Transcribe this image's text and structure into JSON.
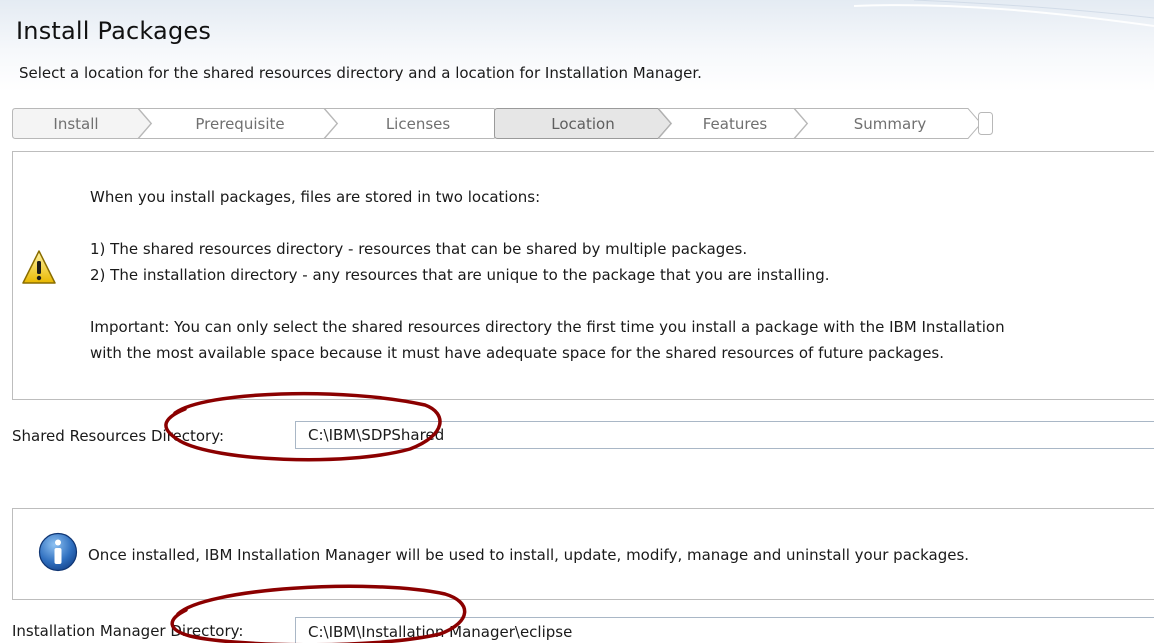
{
  "header": {
    "title": "Install Packages",
    "subtitle": "Select a location for the shared resources directory and a location for Installation Manager."
  },
  "wizard": {
    "steps": [
      {
        "label": "Install",
        "active": false
      },
      {
        "label": "Prerequisite",
        "active": false
      },
      {
        "label": "Licenses",
        "active": false
      },
      {
        "label": "Location",
        "active": true
      },
      {
        "label": "Features",
        "active": false
      },
      {
        "label": "Summary",
        "active": false
      }
    ]
  },
  "warning_panel": {
    "icon": "warning-icon",
    "intro": "When you install packages, files are stored in two locations:",
    "item1": "1) The shared resources directory - resources that can be shared by multiple packages.",
    "item2": "2) The installation directory - any resources that are unique to the package that you are installing.",
    "important_line1": "Important: You can only select the shared resources directory the first time you install a package with the IBM Installation",
    "important_line2": "with the most available space because it must have adequate space for the shared resources of future packages."
  },
  "shared_resources": {
    "label": "Shared Resources Directory:",
    "value": "C:\\IBM\\SDPShared"
  },
  "info_panel": {
    "icon": "info-icon",
    "text": "Once installed, IBM Installation Manager will be used to install, update, modify, manage and uninstall your packages."
  },
  "installation_manager": {
    "label": "Installation Manager Directory:",
    "value": "C:\\IBM\\Installation Manager\\eclipse"
  },
  "colors": {
    "annotation": "#8b0000",
    "header_gradient_top": "#e4ebf3",
    "step_active_fill": "#e6e6e6",
    "step_text": "#707070"
  }
}
